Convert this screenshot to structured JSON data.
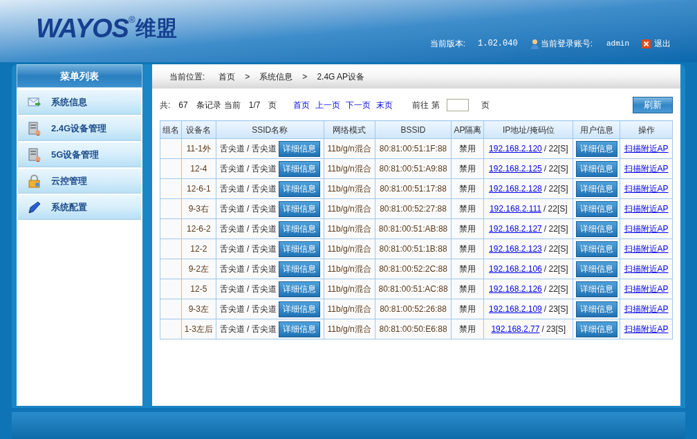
{
  "header": {
    "logo": {
      "brand": "WAYOS",
      "mark": "®",
      "name": "维盟"
    },
    "version_label": "当前版本:",
    "version": "1.02.040",
    "account_label": "当前登录账号:",
    "account": "admin",
    "logout": "退出"
  },
  "sidebar": {
    "title": "菜单列表",
    "items": [
      {
        "label": "系统信息"
      },
      {
        "label": "2.4G设备管理"
      },
      {
        "label": "5G设备管理"
      },
      {
        "label": "云控管理"
      },
      {
        "label": "系统配置"
      }
    ]
  },
  "breadcrumb": {
    "label": "当前位置:",
    "crumbs": [
      "首页",
      "系统信息",
      "2.4G AP设备"
    ],
    "separators": [
      ">",
      ">"
    ]
  },
  "pagination": {
    "total_label": "共:",
    "total": "67",
    "records_label": "条记录",
    "current_label": "当前",
    "page": "1/7",
    "page_label": "页",
    "links": [
      "首页",
      "上一页",
      "下一页",
      "末页"
    ],
    "goto_label": "前往 第",
    "goto_suffix": "页",
    "refresh": "刷新"
  },
  "table": {
    "columns": [
      "组名",
      "设备名",
      "SSID名称",
      "网络模式",
      "BSSID",
      "AP隔离",
      "IP地址/掩码位",
      "用户信息",
      "操作"
    ],
    "rows": [
      {
        "device": "11-1外",
        "ssid": "舌尖道 / 舌尖道",
        "ssid_button": "详细信息",
        "mode": "11b/g/n混合",
        "bssid": "80:81:00:51:1F:88",
        "isolation": "禁用",
        "ip": "192.168.2.120",
        "mask": "/ 22[S]",
        "user_button": "详细信息",
        "action": "扫描附近AP"
      },
      {
        "device": "12-4",
        "ssid": "舌尖道 / 舌尖道",
        "ssid_button": "详细信息",
        "mode": "11b/g/n混合",
        "bssid": "80:81:00:51:A9:88",
        "isolation": "禁用",
        "ip": "192.168.2.125",
        "mask": "/ 22[S]",
        "user_button": "详细信息",
        "action": "扫描附近AP"
      },
      {
        "device": "12-6-1",
        "ssid": "舌尖道 / 舌尖道",
        "ssid_button": "详细信息",
        "mode": "11b/g/n混合",
        "bssid": "80:81:00:51:17:88",
        "isolation": "禁用",
        "ip": "192.168.2.128",
        "mask": "/ 22[S]",
        "user_button": "详细信息",
        "action": "扫描附近AP"
      },
      {
        "device": "9-3右",
        "ssid": "舌尖道 / 舌尖道",
        "ssid_button": "详细信息",
        "mode": "11b/g/n混合",
        "bssid": "80:81:00:52:27:88",
        "isolation": "禁用",
        "ip": "192.168.2.111",
        "mask": "/ 22[S]",
        "user_button": "详细信息",
        "action": "扫描附近AP"
      },
      {
        "device": "12-6-2",
        "ssid": "舌尖道 / 舌尖道",
        "ssid_button": "详细信息",
        "mode": "11b/g/n混合",
        "bssid": "80:81:00:51:AB:88",
        "isolation": "禁用",
        "ip": "192.168.2.127",
        "mask": "/ 22[S]",
        "user_button": "详细信息",
        "action": "扫描附近AP"
      },
      {
        "device": "12-2",
        "ssid": "舌尖道 / 舌尖道",
        "ssid_button": "详细信息",
        "mode": "11b/g/n混合",
        "bssid": "80:81:00:51:1B:88",
        "isolation": "禁用",
        "ip": "192.168.2.123",
        "mask": "/ 22[S]",
        "user_button": "详细信息",
        "action": "扫描附近AP"
      },
      {
        "device": "9-2左",
        "ssid": "舌尖道 / 舌尖道",
        "ssid_button": "详细信息",
        "mode": "11b/g/n混合",
        "bssid": "80:81:00:52:2C:88",
        "isolation": "禁用",
        "ip": "192.168.2.106",
        "mask": "/ 22[S]",
        "user_button": "详细信息",
        "action": "扫描附近AP"
      },
      {
        "device": "12-5",
        "ssid": "舌尖道 / 舌尖道",
        "ssid_button": "详细信息",
        "mode": "11b/g/n混合",
        "bssid": "80:81:00:51:AC:88",
        "isolation": "禁用",
        "ip": "192.168.2.126",
        "mask": "/ 22[S]",
        "user_button": "详细信息",
        "action": "扫描附近AP"
      },
      {
        "device": "9-3左",
        "ssid": "舌尖道 / 舌尖道",
        "ssid_button": "详细信息",
        "mode": "11b/g/n混合",
        "bssid": "80:81:00:52:26:88",
        "isolation": "禁用",
        "ip": "192.168.2.109",
        "mask": "/ 23[S]",
        "user_button": "详细信息",
        "action": "扫描附近AP"
      },
      {
        "device": "1-3左后",
        "ssid": "舌尖道 / 舌尖道",
        "ssid_button": "详细信息",
        "mode": "11b/g/n混合",
        "bssid": "80:81:00:50:E6:88",
        "isolation": "禁用",
        "ip": "192.168.2.77",
        "mask": "/ 23[S]",
        "user_button": "详细信息",
        "action": "扫描附近AP"
      }
    ]
  }
}
